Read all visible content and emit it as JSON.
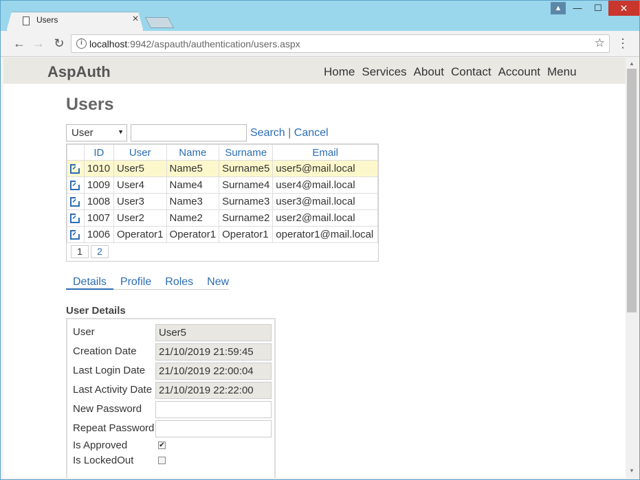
{
  "browser": {
    "tab_title": "Users",
    "tab_close": "×",
    "url_host": "localhost",
    "url_rest": ":9942/aspauth/authentication/users.aspx",
    "window_buttons": {
      "minimize": "—",
      "maximize": "☐",
      "close": "✕",
      "user": "👤"
    }
  },
  "site": {
    "brand": "AspAuth",
    "nav": [
      "Home",
      "Services",
      "About",
      "Contact",
      "Account",
      "Menu"
    ]
  },
  "page": {
    "title": "Users",
    "search": {
      "field_selected": "User",
      "query_value": "",
      "search_label": "Search",
      "separator": "|",
      "cancel_label": "Cancel"
    },
    "grid": {
      "columns": [
        "ID",
        "User",
        "Name",
        "Surname",
        "Email"
      ],
      "rows": [
        {
          "id": "1010",
          "user": "User5",
          "name": "Name5",
          "surname": "Surname5",
          "email": "user5@mail.local",
          "selected": true
        },
        {
          "id": "1009",
          "user": "User4",
          "name": "Name4",
          "surname": "Surname4",
          "email": "user4@mail.local"
        },
        {
          "id": "1008",
          "user": "User3",
          "name": "Name3",
          "surname": "Surname3",
          "email": "user3@mail.local"
        },
        {
          "id": "1007",
          "user": "User2",
          "name": "Name2",
          "surname": "Surname2",
          "email": "user2@mail.local"
        },
        {
          "id": "1006",
          "user": "Operator1",
          "name": "Operator1",
          "surname": "Operator1",
          "email": "operator1@mail.local"
        }
      ],
      "pages": [
        "1",
        "2"
      ],
      "current_page": "1"
    },
    "tabs": [
      "Details",
      "Profile",
      "Roles",
      "New"
    ],
    "active_tab": "Details",
    "details": {
      "title": "User Details",
      "fields": {
        "user": {
          "label": "User",
          "value": "User5"
        },
        "creation_date": {
          "label": "Creation Date",
          "value": "21/10/2019 21:59:45"
        },
        "last_login_date": {
          "label": "Last Login Date",
          "value": "21/10/2019 22:00:04"
        },
        "last_activity_date": {
          "label": "Last Activity Date",
          "value": "21/10/2019 22:22:00"
        },
        "new_password": {
          "label": "New Password",
          "value": ""
        },
        "repeat_password": {
          "label": "Repeat Password",
          "value": ""
        },
        "is_approved": {
          "label": "Is Approved",
          "checked": true
        },
        "is_lockedout": {
          "label": "Is LockedOut",
          "checked": false
        }
      }
    }
  }
}
